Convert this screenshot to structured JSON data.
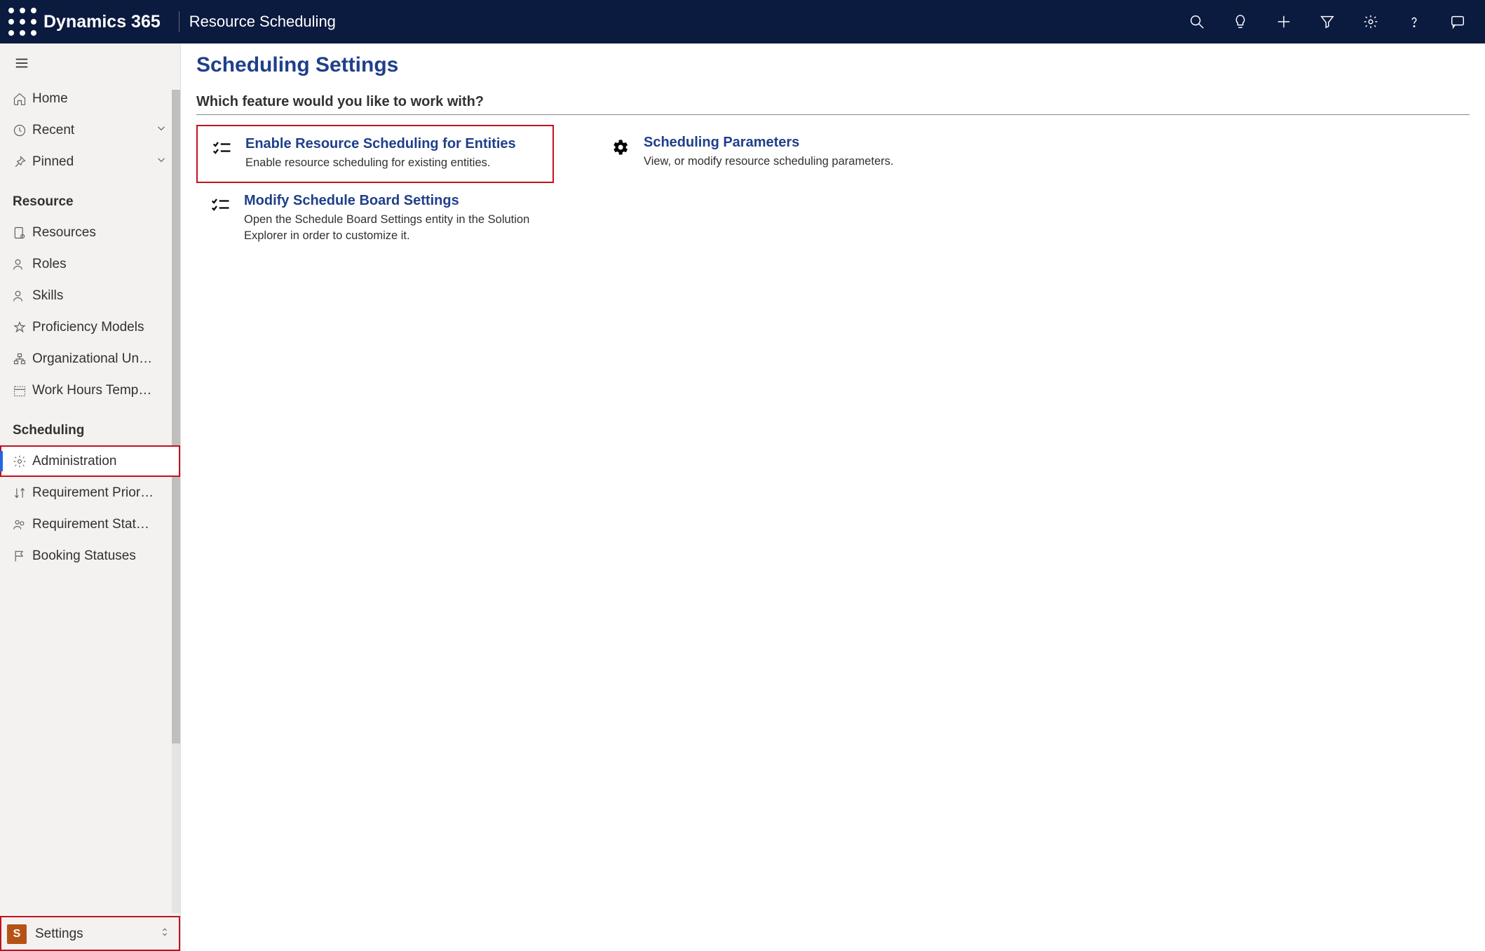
{
  "header": {
    "brand": "Dynamics 365",
    "subtitle": "Resource Scheduling"
  },
  "sidebar": {
    "top": [
      {
        "label": "Home",
        "icon": "home"
      },
      {
        "label": "Recent",
        "icon": "clock",
        "expandable": true
      },
      {
        "label": "Pinned",
        "icon": "pin",
        "expandable": true
      }
    ],
    "groups": [
      {
        "title": "Resource",
        "items": [
          {
            "label": "Resources",
            "icon": "resource"
          },
          {
            "label": "Roles",
            "icon": "person"
          },
          {
            "label": "Skills",
            "icon": "person"
          },
          {
            "label": "Proficiency Models",
            "icon": "star"
          },
          {
            "label": "Organizational Un…",
            "icon": "org"
          },
          {
            "label": "Work Hours Temp…",
            "icon": "calendar"
          }
        ]
      },
      {
        "title": "Scheduling",
        "items": [
          {
            "label": "Administration",
            "icon": "gear",
            "selected": true,
            "redbox": true
          },
          {
            "label": "Requirement Prior…",
            "icon": "sort"
          },
          {
            "label": "Requirement Stat…",
            "icon": "people"
          },
          {
            "label": "Booking Statuses",
            "icon": "flag"
          }
        ]
      }
    ],
    "area": {
      "badge": "S",
      "label": "Settings"
    }
  },
  "main": {
    "title": "Scheduling Settings",
    "prompt": "Which feature would you like to work with?",
    "tiles": [
      {
        "title": "Enable Resource Scheduling for Entities",
        "desc": "Enable resource scheduling for existing entities.",
        "icon": "checklist",
        "col": "left",
        "highlight": true
      },
      {
        "title": "Scheduling Parameters",
        "desc": "View, or modify resource scheduling parameters.",
        "icon": "gear",
        "col": "right"
      },
      {
        "title": "Modify Schedule Board Settings",
        "desc": "Open the Schedule Board Settings entity in the Solution Explorer in order to customize it.",
        "icon": "checklist",
        "col": "left"
      }
    ]
  }
}
